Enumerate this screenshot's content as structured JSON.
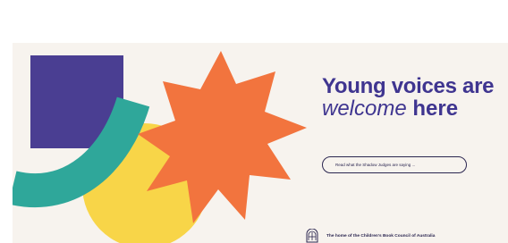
{
  "hero": {
    "headline_line1": "Young voices are",
    "headline_line2_italic": "welcome",
    "headline_line2_bold": "here",
    "cta_label": "Read what the Shadow Judges are saying ..."
  },
  "footer": {
    "text": "The home of the Children's Book Council of Australia",
    "logo_icon": "cbca-logo-icon"
  },
  "colors": {
    "background": "#f7f3ee",
    "purple": "#4a3e92",
    "teal": "#2fa79a",
    "yellow": "#f8d548",
    "orange": "#f2743e",
    "text": "#3f3590"
  }
}
